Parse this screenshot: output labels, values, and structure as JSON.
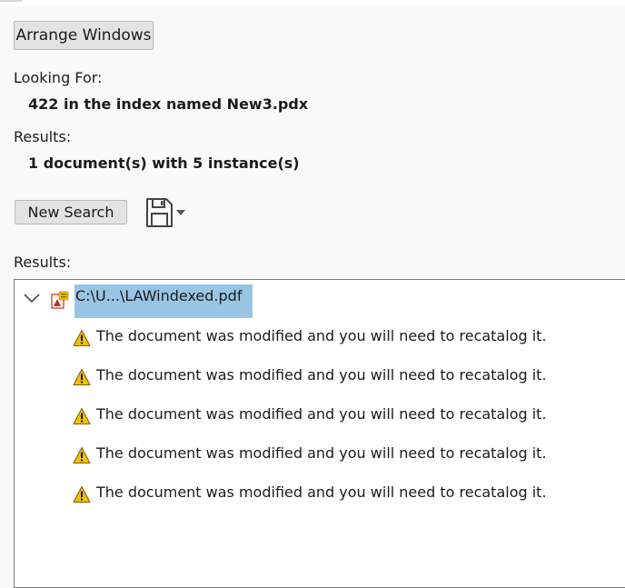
{
  "window": {
    "arrange_label": "Arrange Windows"
  },
  "query": {
    "looking_for_label": "Looking For:",
    "looking_for_value": "422 in the index named New3.pdx",
    "results_label": "Results:",
    "results_value": "1 document(s) with 5 instance(s)"
  },
  "toolbar": {
    "new_search_label": "New Search",
    "save_icon": "save-icon"
  },
  "results_list": {
    "label": "Results:",
    "file": {
      "name": "C:\\U...\\LAWindexed.pdf",
      "icon": "pdf-index-icon",
      "expanded": true
    },
    "items": [
      {
        "icon": "warning-icon",
        "message": "The document was modified and you will need to recatalog it."
      },
      {
        "icon": "warning-icon",
        "message": "The document was modified and you will need to recatalog it."
      },
      {
        "icon": "warning-icon",
        "message": "The document was modified and you will need to recatalog it."
      },
      {
        "icon": "warning-icon",
        "message": "The document was modified and you will need to recatalog it."
      },
      {
        "icon": "warning-icon",
        "message": "The document was modified and you will need to recatalog it."
      }
    ]
  },
  "colors": {
    "background": "#f9f9f9",
    "button": "#e3e3e3",
    "selection": "#99c5e4",
    "warning": "#f2c100"
  }
}
